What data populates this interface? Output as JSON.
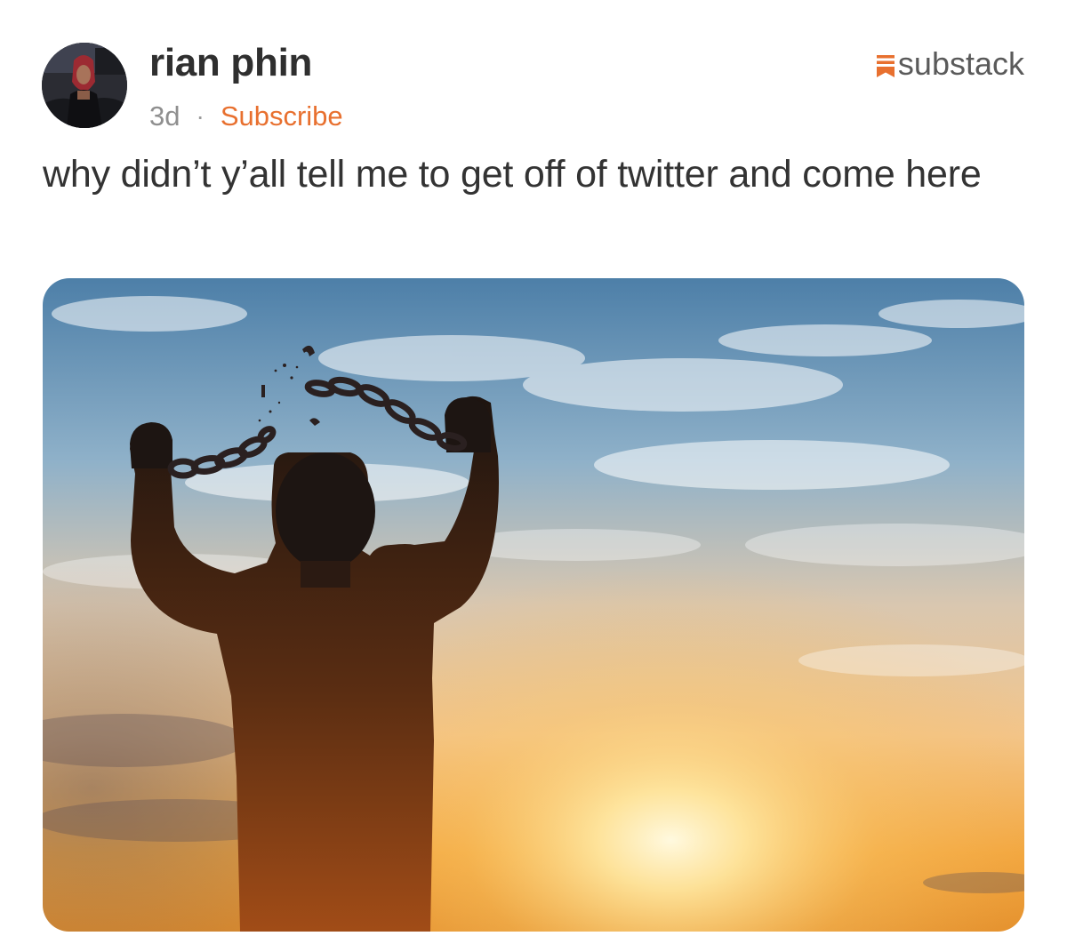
{
  "post": {
    "author_name": "rian phin",
    "age": "3d",
    "separator": "·",
    "subscribe_label": "Subscribe",
    "body_text": "why didn’t y’all tell me to get off of twitter and come here"
  },
  "brand": {
    "name": "substack",
    "icon": "substack-logo-icon",
    "accent_color": "#e8702f"
  },
  "avatar": {
    "icon": "avatar"
  },
  "image": {
    "icon": "silhouette-breaking-chains-sunset-image"
  }
}
